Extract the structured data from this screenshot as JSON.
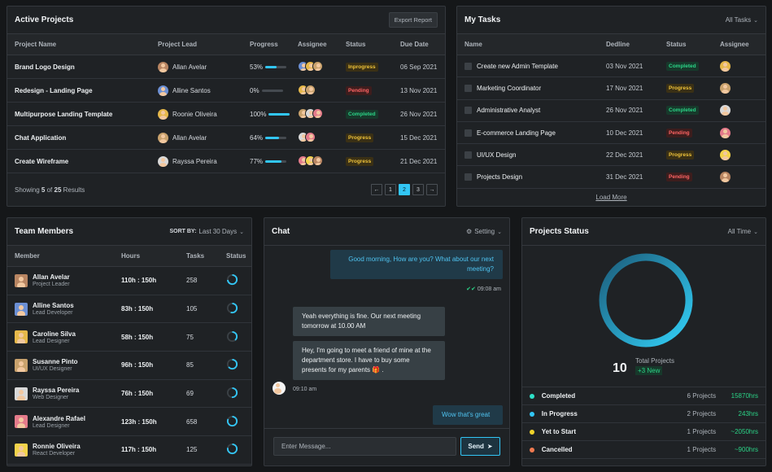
{
  "active_projects": {
    "title": "Active Projects",
    "export_label": "Export Report",
    "headers": [
      "Project Name",
      "Project Lead",
      "Progress",
      "Assignee",
      "Status",
      "Due Date"
    ],
    "rows": [
      {
        "name": "Brand Logo Design",
        "lead": "Allan Avelar",
        "progress": "53%",
        "progress_value": 53,
        "status": "Inprogress",
        "status_color": "yellow",
        "due": "06 Sep 2021"
      },
      {
        "name": "Redesign - Landing Page",
        "lead": "Alline Santos",
        "progress": "0%",
        "progress_value": 0,
        "status": "Pending",
        "status_color": "red",
        "due": "13 Nov 2021"
      },
      {
        "name": "Multipurpose Landing Template",
        "lead": "Roonie Oliveira",
        "progress": "100%",
        "progress_value": 100,
        "status": "Completed",
        "status_color": "green",
        "due": "26 Nov 2021"
      },
      {
        "name": "Chat Application",
        "lead": "Allan Avelar",
        "progress": "64%",
        "progress_value": 64,
        "status": "Progress",
        "status_color": "yellow",
        "due": "15 Dec 2021"
      },
      {
        "name": "Create Wireframe",
        "lead": "Rayssa Pereira",
        "progress": "77%",
        "progress_value": 77,
        "status": "Progress",
        "status_color": "yellow",
        "due": "21 Dec 2021"
      }
    ],
    "showing_prefix": "Showing ",
    "showing_count": "5",
    "showing_mid": " of ",
    "showing_total": "25",
    "showing_suffix": " Results",
    "pagination": {
      "prev": "←",
      "pages": [
        "1",
        "2",
        "3"
      ],
      "active": "2",
      "next": "→"
    }
  },
  "my_tasks": {
    "title": "My Tasks",
    "filter": "All Tasks",
    "headers": [
      "Name",
      "Dedline",
      "Status",
      "Assignee"
    ],
    "rows": [
      {
        "name": "Create new Admin Template",
        "date": "03 Nov 2021",
        "status": "Completed",
        "status_color": "green"
      },
      {
        "name": "Marketing Coordinator",
        "date": "17 Nov 2021",
        "status": "Progress",
        "status_color": "yellow"
      },
      {
        "name": "Administrative Analyst",
        "date": "26 Nov 2021",
        "status": "Completed",
        "status_color": "green"
      },
      {
        "name": "E-commerce Landing Page",
        "date": "10 Dec 2021",
        "status": "Pending",
        "status_color": "red"
      },
      {
        "name": "UI/UX Design",
        "date": "22 Dec 2021",
        "status": "Progress",
        "status_color": "yellow"
      },
      {
        "name": "Projects Design",
        "date": "31 Dec 2021",
        "status": "Pending",
        "status_color": "red"
      }
    ],
    "load_more": "Load More"
  },
  "team": {
    "title": "Team Members",
    "sort_label": "SORT BY:",
    "sort_value": "Last 30 Days",
    "headers": [
      "Member",
      "Hours",
      "Tasks",
      "Status"
    ],
    "rows": [
      {
        "name": "Allan Avelar",
        "role": "Project Leader",
        "hours": "110h",
        "total": " : 150h",
        "tasks": "258",
        "pct": 0.73
      },
      {
        "name": "Alline Santos",
        "role": "Lead Developer",
        "hours": "83h",
        "total": " : 150h",
        "tasks": "105",
        "pct": 0.55
      },
      {
        "name": "Caroline Silva",
        "role": "Lead Designer",
        "hours": "58h",
        "total": " : 150h",
        "tasks": "75",
        "pct": 0.39
      },
      {
        "name": "Susanne Pinto",
        "role": "UI/UX Designer",
        "hours": "96h",
        "total": " : 150h",
        "tasks": "85",
        "pct": 0.64
      },
      {
        "name": "Rayssa Pereira",
        "role": "Web Designer",
        "hours": "76h",
        "total": " : 150h",
        "tasks": "69",
        "pct": 0.51
      },
      {
        "name": "Alexandre Rafael",
        "role": "Lead Designer",
        "hours": "123h",
        "total": " : 150h",
        "tasks": "658",
        "pct": 0.82
      },
      {
        "name": "Ronnie Oliveira",
        "role": "React Developer",
        "hours": "117h",
        "total": " : 150h",
        "tasks": "125",
        "pct": 0.78
      }
    ]
  },
  "chat": {
    "title": "Chat",
    "setting": "Setting",
    "msg1": "Good morning, How are you? What about our next meeting?",
    "time1": "09:08 am",
    "msg2": "Yeah everything is fine. Our next meeting tomorrow at 10.00 AM",
    "msg3": "Hey, I'm going to meet a friend of mine at the department store. I have to buy some presents for my parents",
    "emoji": "🎁 .",
    "time2": "09:10 am",
    "msg4": "Wow that's great",
    "placeholder": "Enter Message...",
    "send": "Send"
  },
  "status": {
    "title": "Projects Status",
    "filter": "All Time",
    "total": "10",
    "total_label": "Total Projects",
    "new_label": "+3 New",
    "ring_color": "#32c6f5",
    "legend": [
      {
        "label": "Completed",
        "projects": "6 Projects",
        "hours": "15870hrs",
        "color": "#2de0c8"
      },
      {
        "label": "In Progress",
        "projects": "2 Projects",
        "hours": "243hrs",
        "color": "#32c6f5"
      },
      {
        "label": "Yet to Start",
        "projects": "1 Projects",
        "hours": "~2050hrs",
        "color": "#f0d32a"
      },
      {
        "label": "Cancelled",
        "projects": "1 Projects",
        "hours": "~900hrs",
        "color": "#f07a50"
      }
    ]
  }
}
